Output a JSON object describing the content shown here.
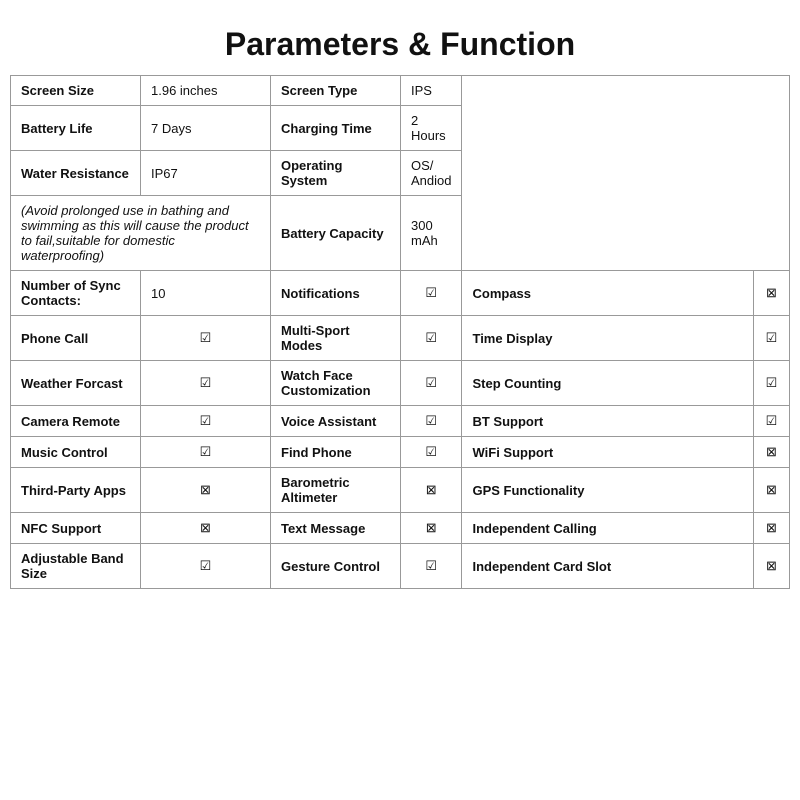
{
  "title": "Parameters & Function",
  "specs": {
    "screen_size_label": "Screen Size",
    "screen_size_value": "1.96 inches",
    "screen_type_label": "Screen Type",
    "screen_type_value": "IPS",
    "battery_life_label": "Battery Life",
    "battery_life_value": "7 Days",
    "charging_time_label": "Charging Time",
    "charging_time_value": "2 Hours",
    "water_resistance_label": "Water Resistance",
    "water_resistance_value": "IP67",
    "water_note": "(Avoid prolonged use in bathing and swimming as this will cause the product to fail,suitable for domestic waterproofing)",
    "operating_system_label": "Operating System",
    "operating_system_value": "OS/ Andiod",
    "battery_capacity_label": "Battery Capacity",
    "battery_capacity_value": "300 mAh"
  },
  "features": {
    "sync_contacts_label": "Number of Sync Contacts:",
    "sync_contacts_value": "10",
    "notifications_label": "Notifications",
    "notifications_check": "☑",
    "compass_label": "Compass",
    "compass_check": "⊠",
    "phone_call_label": "Phone Call",
    "phone_call_check": "☑",
    "multi_sport_label": "Multi-Sport Modes",
    "multi_sport_check": "☑",
    "time_display_label": "Time Display",
    "time_display_check": "☑",
    "weather_label": "Weather Forcast",
    "weather_check": "☑",
    "watch_face_label": "Watch Face Customization",
    "watch_face_check": "☑",
    "step_counting_label": "Step Counting",
    "step_counting_check": "☑",
    "camera_remote_label": "Camera Remote",
    "camera_remote_check": "☑",
    "voice_assistant_label": "Voice Assistant",
    "voice_assistant_check": "☑",
    "bt_support_label": "BT Support",
    "bt_support_check": "☑",
    "music_control_label": "Music Control",
    "music_control_check": "☑",
    "find_phone_label": "Find Phone",
    "find_phone_check": "☑",
    "wifi_support_label": "WiFi Support",
    "wifi_support_check": "⊠",
    "third_party_label": "Third-Party Apps",
    "third_party_check": "⊠",
    "barometric_label": "Barometric Altimeter",
    "barometric_check": "⊠",
    "gps_label": "GPS Functionality",
    "gps_check": "⊠",
    "nfc_label": "NFC Support",
    "nfc_check": "⊠",
    "text_message_label": "Text Message",
    "text_message_check": "⊠",
    "independent_calling_label": "Independent Calling",
    "independent_calling_check": "⊠",
    "adjustable_band_label": "Adjustable Band Size",
    "adjustable_band_check": "☑",
    "gesture_control_label": "Gesture Control",
    "gesture_control_check": "☑",
    "independent_card_label": "Independent Card Slot",
    "independent_card_check": "⊠"
  }
}
